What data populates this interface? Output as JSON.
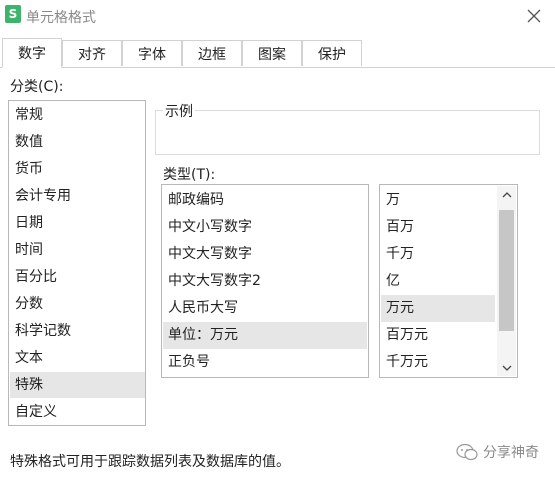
{
  "window": {
    "title": "单元格格式",
    "app_icon_letter": "S"
  },
  "tabs": [
    {
      "label": "数字",
      "active": true
    },
    {
      "label": "对齐"
    },
    {
      "label": "字体"
    },
    {
      "label": "边框"
    },
    {
      "label": "图案"
    },
    {
      "label": "保护"
    }
  ],
  "category": {
    "label": "分类(C):",
    "items": [
      "常规",
      "数值",
      "货币",
      "会计专用",
      "日期",
      "时间",
      "百分比",
      "分数",
      "科学记数",
      "文本",
      "特殊",
      "自定义"
    ],
    "selected": "特殊"
  },
  "sample": {
    "label": "示例",
    "value": ""
  },
  "type": {
    "label": "类型(T):",
    "items": [
      "邮政编码",
      "中文小写数字",
      "中文大写数字",
      "中文大写数字2",
      "人民币大写",
      "单位：万元",
      "正负号"
    ],
    "selected": "单位：万元"
  },
  "unit": {
    "items": [
      "万",
      "百万",
      "千万",
      "亿",
      "万元",
      "百万元",
      "千万元"
    ],
    "selected": "万元"
  },
  "description": "特殊格式可用于跟踪数据列表及数据库的值。",
  "watermark": {
    "text": "分享神奇"
  },
  "colors": {
    "selected_bg": "#e6e6e6",
    "border": "#b8b8b8",
    "icon_green": "#3db36b",
    "scroll_thumb": "#c6c6c6"
  },
  "icons": {
    "app": "spreadsheet-app-icon",
    "close": "close-icon",
    "scroll_up": "chevron-up-icon",
    "scroll_down": "chevron-down-icon",
    "watermark": "wechat-icon"
  }
}
